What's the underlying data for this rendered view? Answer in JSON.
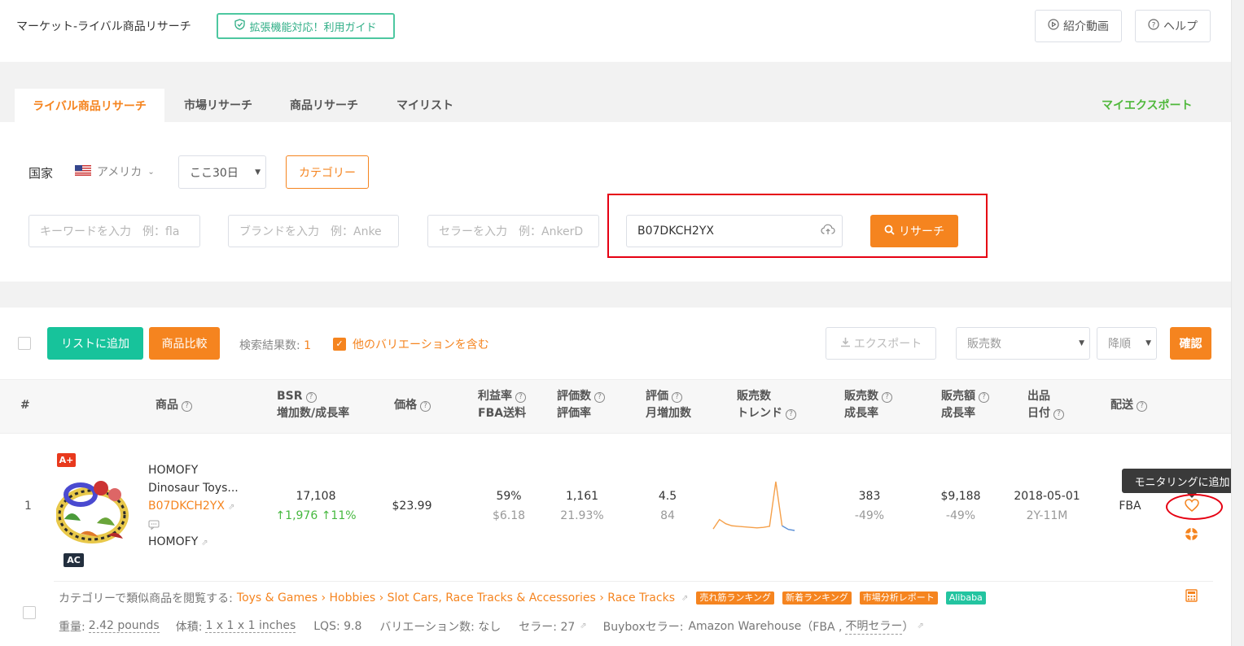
{
  "header": {
    "title": "マーケット-ライバル商品リサーチ",
    "guide_label": "拡張機能対応！利用ガイド",
    "video_label": "紹介動画",
    "help_label": "ヘルプ"
  },
  "tabs": [
    {
      "label": "ライバル商品リサーチ",
      "active": true
    },
    {
      "label": "市場リサーチ"
    },
    {
      "label": "商品リサーチ"
    },
    {
      "label": "マイリスト"
    }
  ],
  "my_export_label": "マイエクスポート",
  "filters": {
    "country_label": "国家",
    "country_value": "アメリカ",
    "period_value": "ここ30日",
    "category_label": "カテゴリー",
    "keyword_placeholder": "キーワードを入力　例：fla",
    "brand_placeholder": "ブランドを入力　例：Anke",
    "seller_placeholder": "セラーを入力　例：AnkerD",
    "asin_value": "B07DKCH2YX",
    "search_label": "リサーチ"
  },
  "toolbar": {
    "add_list_label": "リストに追加",
    "compare_label": "商品比較",
    "result_count_label": "検索結果数:",
    "result_count": "1",
    "variation_label": "他のバリエーションを含む",
    "export_label": "エクスポート",
    "sort_placeholder": "販売数",
    "order_placeholder": "降順",
    "confirm_label": "確認"
  },
  "table": {
    "headers": {
      "index": "#",
      "product": "商品",
      "bsr_1": "BSR",
      "bsr_2": "増加数/成長率",
      "price": "価格",
      "margin_1": "利益率",
      "margin_2": "FBA送料",
      "reviews_1": "評価数",
      "reviews_2": "評価率",
      "rating_1": "評価",
      "rating_2": "月増加数",
      "trend_1": "販売数",
      "trend_2": "トレンド",
      "sales_1": "販売数",
      "sales_2": "成長率",
      "revenue_1": "販売額",
      "revenue_2": "成長率",
      "date_1": "出品",
      "date_2": "日付",
      "ship": "配送"
    },
    "row": {
      "index": "1",
      "badge_aplus": "A+",
      "badge_ac": "AC",
      "brand": "HOMOFY",
      "title": "Dinosaur Toys...",
      "asin": "B07DKCH2YX",
      "seller": "HOMOFY",
      "bsr": "17,108",
      "bsr_increase": "↑1,976",
      "bsr_rate": "↑11%",
      "price": "$23.99",
      "margin": "59%",
      "fba_fee": "$6.18",
      "reviews": "1,161",
      "review_rate": "21.93%",
      "rating": "4.5",
      "rating_monthly": "84",
      "sales": "383",
      "sales_growth": "-49%",
      "revenue": "$9,188",
      "revenue_growth": "-49%",
      "date": "2018-05-01",
      "age": "2Y-11M",
      "shipping": "FBA",
      "tooltip": "モニタリングに追加",
      "trend_values": [
        4,
        22,
        14,
        10,
        9,
        8,
        7,
        6,
        7,
        9,
        95,
        10,
        3,
        1
      ]
    },
    "detail": {
      "category_prefix": "カテゴリーで類似商品を閲覧する:",
      "category_path": "Toys & Games › Hobbies › Slot Cars, Race Tracks & Accessories › Race Tracks",
      "tags": [
        {
          "label": "売れ筋ランキング",
          "color": "#f5841f"
        },
        {
          "label": "新着ランキング",
          "color": "#f5841f"
        },
        {
          "label": "市場分析レポート",
          "color": "#f5841f"
        },
        {
          "label": "Alibaba",
          "color": "#23c4a0"
        }
      ],
      "weight_label": "重量:",
      "weight": "2.42 pounds",
      "size_label": "体積:",
      "size": "1 x 1 x 1 inches",
      "lqs": "LQS: 9.8",
      "variation": "バリエーション数: なし",
      "seller_count": "セラー: 27",
      "buybox_label": "Buyboxセラー:",
      "buybox_name": "Amazon Warehouse",
      "buybox_detail_1": "（FBA ,",
      "buybox_detail_2": "不明セラー",
      "buybox_detail_3": "）"
    }
  },
  "colors": {
    "accent": "#f5841f",
    "teal": "#17c39b",
    "green_text": "#46b83f",
    "highlight_red": "#e60012"
  }
}
